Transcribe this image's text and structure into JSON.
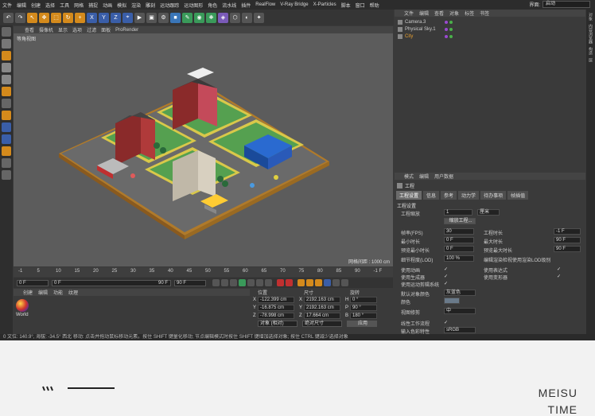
{
  "menubar": {
    "items": [
      "文件",
      "编辑",
      "创建",
      "选择",
      "工具",
      "网格",
      "捕捉",
      "动画",
      "模拟",
      "渲染",
      "雕刻",
      "运动跟踪",
      "运动图形",
      "角色",
      "流水线",
      "插件",
      "RealFlow",
      "V-Ray Bridge",
      "X-Particles",
      "脚本",
      "窗口",
      "帮助"
    ],
    "interface_label": "界面:",
    "interface_value": "启动"
  },
  "viewport": {
    "menu": [
      "查看",
      "摄像机",
      "显示",
      "选项",
      "过滤",
      "面板",
      "ProRender"
    ],
    "view_name": "等角视图",
    "grid_spacing": "网格间距 : 1000 cm"
  },
  "timeline": {
    "ticks": [
      "-1",
      "5",
      "10",
      "15",
      "20",
      "25",
      "30",
      "35",
      "40",
      "45",
      "50",
      "55",
      "60",
      "65",
      "70",
      "75",
      "80",
      "85",
      "90",
      "-1 F"
    ],
    "start_frame": "0 F",
    "range_start": "0 F",
    "range_end": "90 F",
    "end_frame": "90 F"
  },
  "material_panel": {
    "menu": [
      "创建",
      "编辑",
      "功能",
      "纹理"
    ],
    "material_name": "World"
  },
  "coordinates": {
    "headers": [
      "位置",
      "尺寸",
      "旋转"
    ],
    "rows": [
      {
        "axis": "X",
        "pos": "-122.399 cm",
        "size_axis": "X",
        "size": "2192.163 cm",
        "rot_axis": "H",
        "rot": "0 °"
      },
      {
        "axis": "Y",
        "pos": "-16.875 cm",
        "size_axis": "Y",
        "size": "2192.163 cm",
        "rot_axis": "P",
        "rot": "90 °"
      },
      {
        "axis": "Z",
        "pos": "-78.998 cm",
        "size_axis": "Z",
        "size": "17.664 cm",
        "rot_axis": "B",
        "rot": "180 °"
      }
    ],
    "mode_object": "对象 (相对)",
    "mode_size": "绝对尺寸",
    "apply": "应用"
  },
  "status_text": "0 文位: 140.9°, 海拔: -34.5° 西北   移动: 点击并拖动鼠标移动元素。按住 SHIFT 键量化移动; 节点编辑模式时按住 SHIFT 键增加选择对象; 按住 CTRL 键减少选择对象",
  "object_manager": {
    "menu": [
      "文件",
      "编辑",
      "查看",
      "对象",
      "标签",
      "书签"
    ],
    "objects": [
      {
        "name": "Camera.3",
        "color": "#cccccc"
      },
      {
        "name": "Physical Sky.1",
        "color": "#cccccc"
      },
      {
        "name": "City",
        "color": "#e8a030"
      }
    ]
  },
  "attributes": {
    "menu": [
      "模式",
      "编辑",
      "用户数据"
    ],
    "title": "工程",
    "tabs": [
      "工程设置",
      "信息",
      "参考",
      "动力学",
      "待办事项",
      "帧插值"
    ],
    "section": "工程设置",
    "scale_label": "工程缩放",
    "scale_value": "1",
    "scale_unit": "厘米",
    "scale_button": "缩放工程...",
    "fps_label": "帧率(FPS)",
    "fps_value": "30",
    "min_time_label": "最小时长",
    "min_time_value": "0 F",
    "preview_min_label": "预览最小时长",
    "preview_min_value": "0 F",
    "lod_label": "细节程度(LOD)",
    "lod_value": "100 %",
    "project_time_label": "工程时长",
    "project_time_value": "-1 F",
    "max_time_label": "最大时长",
    "max_time_value": "90 F",
    "preview_max_label": "预览最大时长",
    "preview_max_value": "90 F",
    "render_lod_label": "编辑渲染检视使用渲染LOD级别",
    "checks_left": [
      "使用动画",
      "使用生成器",
      "使用运动剪辑系统"
    ],
    "checks_right": [
      "使用表达式",
      "使用变形器"
    ],
    "default_color_label": "默认对象颜色",
    "default_color_value": "灰蓝色",
    "color_label": "颜色",
    "view_clip_label": "视图修剪",
    "view_clip_value": "中",
    "linear_label": "线性工作流程",
    "input_color_label": "输入色彩特性",
    "input_color_value": "sRGB"
  },
  "right_strip": [
    "对象",
    "内容浏览器",
    "构造",
    "层"
  ],
  "footer": {
    "brand_line1": "MEISU",
    "brand_line2": "TIME"
  }
}
